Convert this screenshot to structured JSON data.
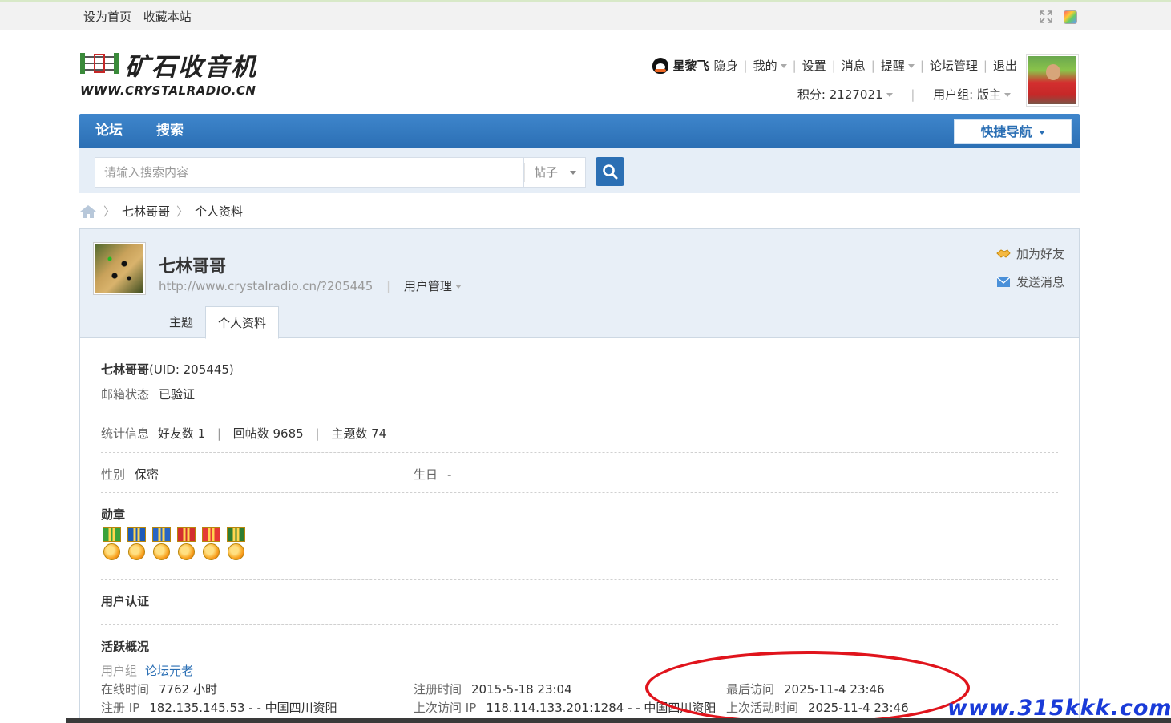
{
  "topbar": {
    "set_home": "设为首页",
    "bookmark": "收藏本站"
  },
  "logo": {
    "cn": "矿石收音机",
    "en": "WWW.CRYSTALRADIO.CN"
  },
  "user_nav": {
    "username": "星黎飞",
    "invisible": "隐身",
    "mine": "我的",
    "settings": "设置",
    "messages": "消息",
    "reminders": "提醒",
    "forum_admin": "论坛管理",
    "logout": "退出",
    "points": "积分: 2127021",
    "user_group": "用户组: 版主"
  },
  "navbar": {
    "forum": "论坛",
    "search": "搜索",
    "quick_nav": "快捷导航"
  },
  "search": {
    "placeholder": "请输入搜索内容",
    "type": "帖子"
  },
  "breadcrumb": {
    "item1": "七林哥哥",
    "item2": "个人资料"
  },
  "profile": {
    "name": "七林哥哥",
    "url": "http://www.crystalradio.cn/?205445",
    "user_manage": "用户管理",
    "add_friend": "加为好友",
    "send_message": "发送消息",
    "tabs": [
      "主题",
      "个人资料"
    ],
    "name_uid": "七林哥哥",
    "uid": "(UID: 205445)",
    "email_label": "邮箱状态",
    "email_value": "已验证",
    "stats_label": "统计信息",
    "friends": "好友数 1",
    "replies": "回帖数 9685",
    "threads": "主题数 74",
    "gender_label": "性别",
    "gender_value": "保密",
    "birthday_label": "生日",
    "birthday_value": "-",
    "medals_title": "勋章",
    "verify_title": "用户认证",
    "activity_title": "活跃概况",
    "group_label": "用户组",
    "group_value": "论坛元老",
    "online_label": "在线时间",
    "online_value": "7762 小时",
    "reg_time_label": "注册时间",
    "reg_time_value": "2015-5-18 23:04",
    "last_visit_label": "最后访问",
    "last_visit_value": "2025-11-4 23:46",
    "reg_ip_label": "注册 IP",
    "reg_ip_value": "182.135.145.53 - - 中国四川资阳",
    "last_ip_label": "上次访问 IP",
    "last_ip_value": "118.114.133.201:1284 - - 中国四川资阳",
    "last_active_label": "上次活动时间",
    "last_active_value": "2025-11-4 23:46"
  },
  "medals": [
    {
      "ribbon": "#3aa23a",
      "name": "medal-star-icon"
    },
    {
      "ribbon": "#1e5bb8",
      "name": "medal-blue-icon"
    },
    {
      "ribbon": "#2a66c4",
      "name": "medal-sun-icon"
    },
    {
      "ribbon": "#d32f2f",
      "name": "medal-red-icon"
    },
    {
      "ribbon": "#e53935",
      "name": "medal-orange-icon"
    },
    {
      "ribbon": "#2e7d32",
      "name": "medal-gold-icon"
    }
  ],
  "watermark": "www.315kkk.com",
  "colors": {
    "nav_blue": "#2b6fb4",
    "search_bg": "#e6eef7",
    "annotation_red": "#e0141c",
    "watermark_blue": "#1a3bd8"
  }
}
